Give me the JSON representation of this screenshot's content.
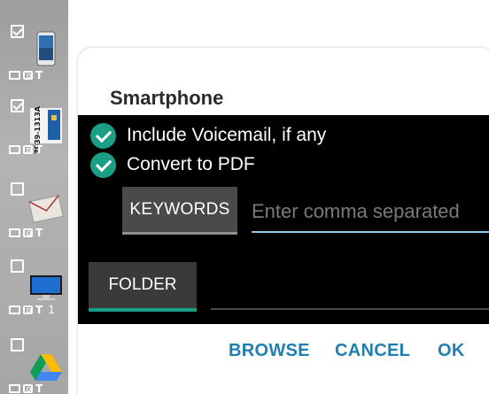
{
  "sidebar": {
    "items": [
      {
        "checked": true,
        "thumb": "smartphone",
        "badge": ""
      },
      {
        "checked": true,
        "thumb": "sim-card",
        "badge": ""
      },
      {
        "checked": false,
        "thumb": "envelope",
        "badge": ""
      },
      {
        "checked": false,
        "thumb": "monitor",
        "badge": "1"
      },
      {
        "checked": false,
        "thumb": "google-drive",
        "badge": ""
      }
    ],
    "tool_text": "T",
    "card_text": "7939-1313A"
  },
  "dialog": {
    "title": "Smartphone",
    "options": [
      {
        "label": "Include Voicemail, if any",
        "checked": true
      },
      {
        "label": "Convert to PDF",
        "checked": true
      }
    ],
    "keywords_label": "KEYWORDS",
    "keywords_placeholder": "Enter comma separated",
    "keywords_value": "",
    "folder_label": "FOLDER",
    "folder_value": "",
    "actions": {
      "browse": "BROWSE",
      "cancel": "CANCEL",
      "ok": "OK"
    }
  },
  "colors": {
    "accent": "#1a9e85",
    "action": "#1e7fb0",
    "input_underline": "#8ec8e8"
  }
}
